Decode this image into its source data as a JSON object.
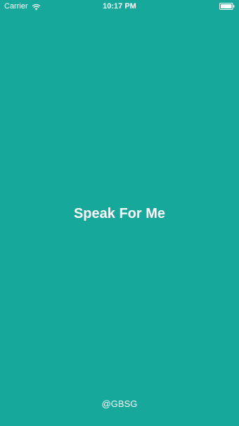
{
  "status_bar": {
    "carrier": "Carrier",
    "time": "10:17 PM",
    "wifi_icon": "wifi-icon",
    "battery_icon": "battery-icon",
    "battery_level": 1.0
  },
  "splash": {
    "title": "Speak For Me",
    "footer": "@GBSG"
  },
  "colors": {
    "background": "#17A89C",
    "text": "#FFFFFF"
  }
}
